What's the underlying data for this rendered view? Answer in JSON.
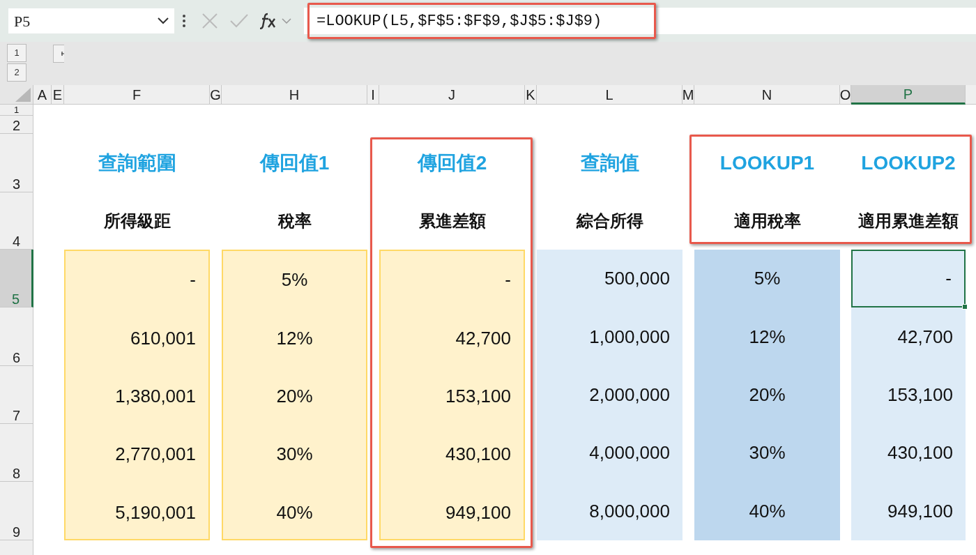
{
  "name_box": "P5",
  "formula": "=LOOKUP(L5,$F$5:$F$9,$J$5:$J$9)",
  "outline_levels": [
    "1",
    "2"
  ],
  "column_headers": [
    {
      "label": "A",
      "selected": false
    },
    {
      "label": "E",
      "selected": false
    },
    {
      "label": "F",
      "selected": false
    },
    {
      "label": "G",
      "selected": false
    },
    {
      "label": "H",
      "selected": false
    },
    {
      "label": "I",
      "selected": false
    },
    {
      "label": "J",
      "selected": false
    },
    {
      "label": "K",
      "selected": false
    },
    {
      "label": "L",
      "selected": false
    },
    {
      "label": "M",
      "selected": false
    },
    {
      "label": "N",
      "selected": false
    },
    {
      "label": "O",
      "selected": false
    },
    {
      "label": "P",
      "selected": true
    }
  ],
  "row_headers": [
    {
      "label": "1",
      "selected": false
    },
    {
      "label": "2",
      "selected": false
    },
    {
      "label": "3",
      "selected": false
    },
    {
      "label": "4",
      "selected": false
    },
    {
      "label": "5",
      "selected": true
    },
    {
      "label": "6",
      "selected": false
    },
    {
      "label": "7",
      "selected": false
    },
    {
      "label": "8",
      "selected": false
    },
    {
      "label": "9",
      "selected": false
    }
  ],
  "table": {
    "columns": [
      {
        "title": "查詢範圍",
        "subtitle": "所得級距",
        "kind": "range",
        "centered": false,
        "values": [
          "-",
          "610,001",
          "1,380,001",
          "2,770,001",
          "5,190,001"
        ]
      },
      {
        "title": "傳回值1",
        "subtitle": "稅率",
        "kind": "range",
        "centered": true,
        "values": [
          "5%",
          "12%",
          "20%",
          "30%",
          "40%"
        ]
      },
      {
        "title": "傳回值2",
        "subtitle": "累進差額",
        "kind": "range",
        "centered": false,
        "values": [
          "-",
          "42,700",
          "153,100",
          "430,100",
          "949,100"
        ]
      },
      {
        "title": "查詢值",
        "subtitle": "綜合所得",
        "kind": "input",
        "centered": false,
        "values": [
          "500,000",
          "1,000,000",
          "2,000,000",
          "4,000,000",
          "8,000,000"
        ]
      },
      {
        "title": "LOOKUP1",
        "subtitle": "適用稅率",
        "kind": "result",
        "centered": true,
        "values": [
          "5%",
          "12%",
          "20%",
          "30%",
          "40%"
        ]
      },
      {
        "title": "LOOKUP2",
        "subtitle": "適用累進差額",
        "kind": "output",
        "centered": false,
        "values": [
          "-",
          "42,700",
          "153,100",
          "430,100",
          "949,100"
        ]
      }
    ]
  }
}
